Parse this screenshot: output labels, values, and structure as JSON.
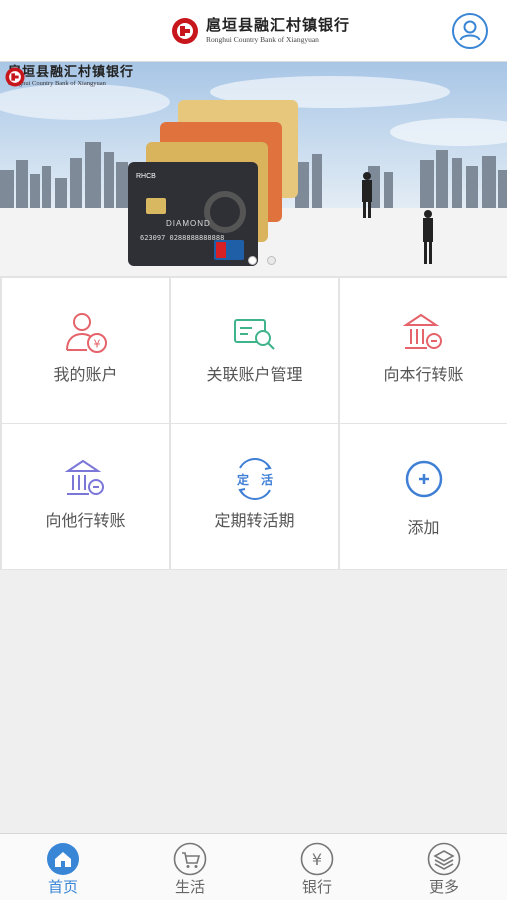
{
  "header": {
    "bank_name_cn": "扈垣县融汇村镇银行",
    "bank_name_en": "Ronghui Country Bank of Xiangyuan",
    "user_icon": "user-icon"
  },
  "banner": {
    "logo_cn": "扈垣县融汇村镇银行",
    "logo_en": "Ronghui Country Bank of Xiangyuan",
    "card_brand": "RHCB",
    "card_label": "DIAMOND",
    "card_number": "623097 0288888888888",
    "slides": 2,
    "active_slide": 1
  },
  "grid": {
    "items": [
      {
        "label": "我的账户",
        "icon": "account-icon"
      },
      {
        "label": "关联账户管理",
        "icon": "linked-account-icon"
      },
      {
        "label": "向本行转账",
        "icon": "bank-transfer-icon"
      },
      {
        "label": "向他行转账",
        "icon": "other-bank-transfer-icon"
      },
      {
        "label": "定期转活期",
        "icon": "fixed-to-current-icon",
        "icon_text_left": "定",
        "icon_text_right": "活"
      },
      {
        "label": "添加",
        "icon": "add-icon"
      }
    ]
  },
  "tabbar": {
    "tabs": [
      {
        "label": "首页",
        "icon": "home-icon",
        "active": true
      },
      {
        "label": "生活",
        "icon": "cart-icon",
        "active": false
      },
      {
        "label": "银行",
        "icon": "yuan-icon",
        "active": false
      },
      {
        "label": "更多",
        "icon": "layers-icon",
        "active": false
      }
    ]
  },
  "colors": {
    "accent": "#3a86d6",
    "icon_red": "#e5636a",
    "icon_green": "#3fb38a",
    "icon_purple": "#7a77d8",
    "icon_blue": "#3f7fd5"
  }
}
